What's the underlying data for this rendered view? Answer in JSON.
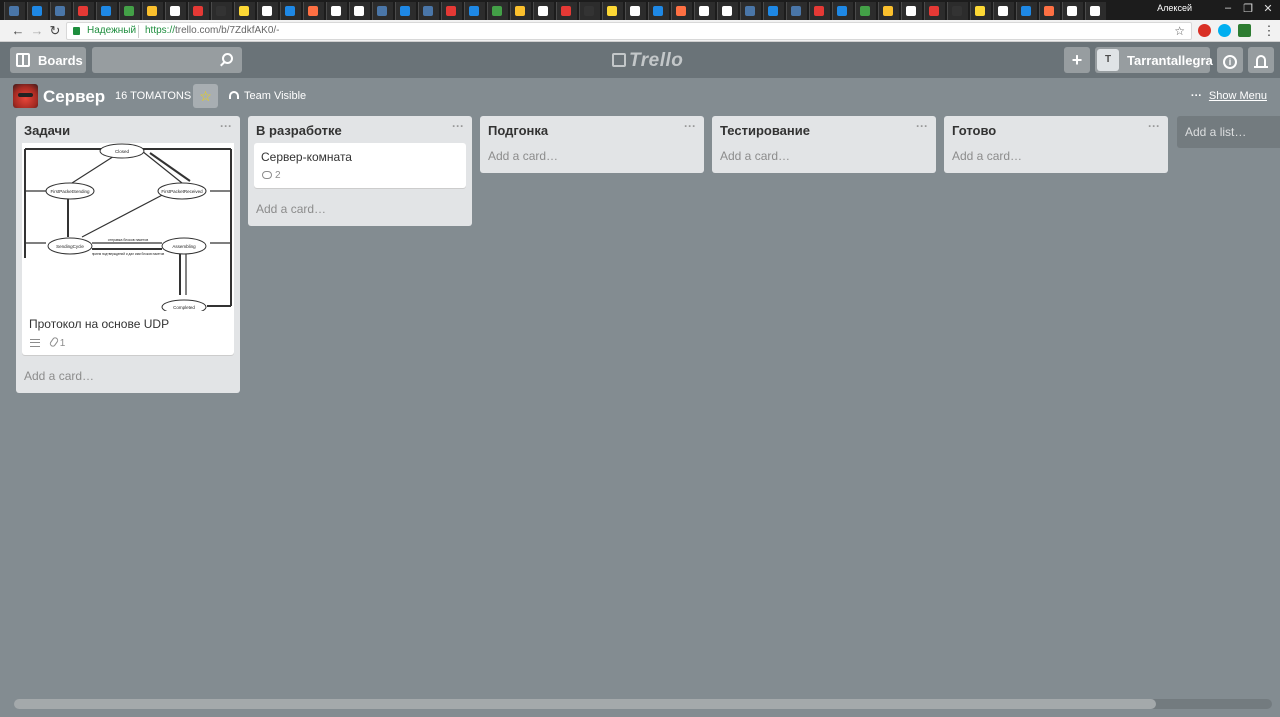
{
  "browser": {
    "tabs_count": 48,
    "window_user": "Алексей",
    "window_controls": [
      "–",
      "❐",
      "✕"
    ],
    "security_label": "Надежный",
    "url_scheme": "https://",
    "url_host": "trello.com",
    "url_path": "/b/7ZdkfAK0/-",
    "colors": {
      "secure": "#1e8e3e"
    },
    "extension_icons": [
      "opera-icon",
      "skype-icon",
      "extension-badge-icon"
    ]
  },
  "header": {
    "boards_label": "Boards",
    "search_placeholder": "",
    "logo_text": "Trello",
    "add_label": "+",
    "member_initial": "T",
    "member_name": "Tarrantallegra",
    "info_label": "i"
  },
  "board": {
    "title": "Сервер",
    "team": "16 TOMATONS",
    "star": "☆",
    "visibility": "Team Visible",
    "menu_dots": "···",
    "show_menu": "Show Menu",
    "colors": {
      "background": "#838c91",
      "header": "#6a7378",
      "list": "#e2e4e6"
    }
  },
  "lists": [
    {
      "title": "Задачи",
      "menu": "···",
      "cards": [
        {
          "title": "Протокол на основе UDP",
          "has_cover": true,
          "cover_diagram": {
            "nodes": [
              "Closed",
              "FirstPacketSending",
              "FirstPacketReceived",
              "SendingCycle",
              "Assembling",
              "Completed"
            ],
            "edge_labels": [
              "отправка блоков пакетов",
              "прием подтверждений и дал ими блоков пакетов"
            ]
          },
          "has_description": true,
          "attachments": "1"
        }
      ],
      "add_card": "Add a card…"
    },
    {
      "title": "В разработке",
      "menu": "···",
      "cards": [
        {
          "title": "Сервер-комната",
          "comments": "2"
        }
      ],
      "add_card": "Add a card…"
    },
    {
      "title": "Подгонка",
      "menu": "···",
      "cards": [],
      "add_card": "Add a card…"
    },
    {
      "title": "Тестирование",
      "menu": "···",
      "cards": [],
      "add_card": "Add a card…"
    },
    {
      "title": "Готово",
      "menu": "···",
      "cards": [],
      "add_card": "Add a card…"
    }
  ],
  "add_list": "Add a list…"
}
